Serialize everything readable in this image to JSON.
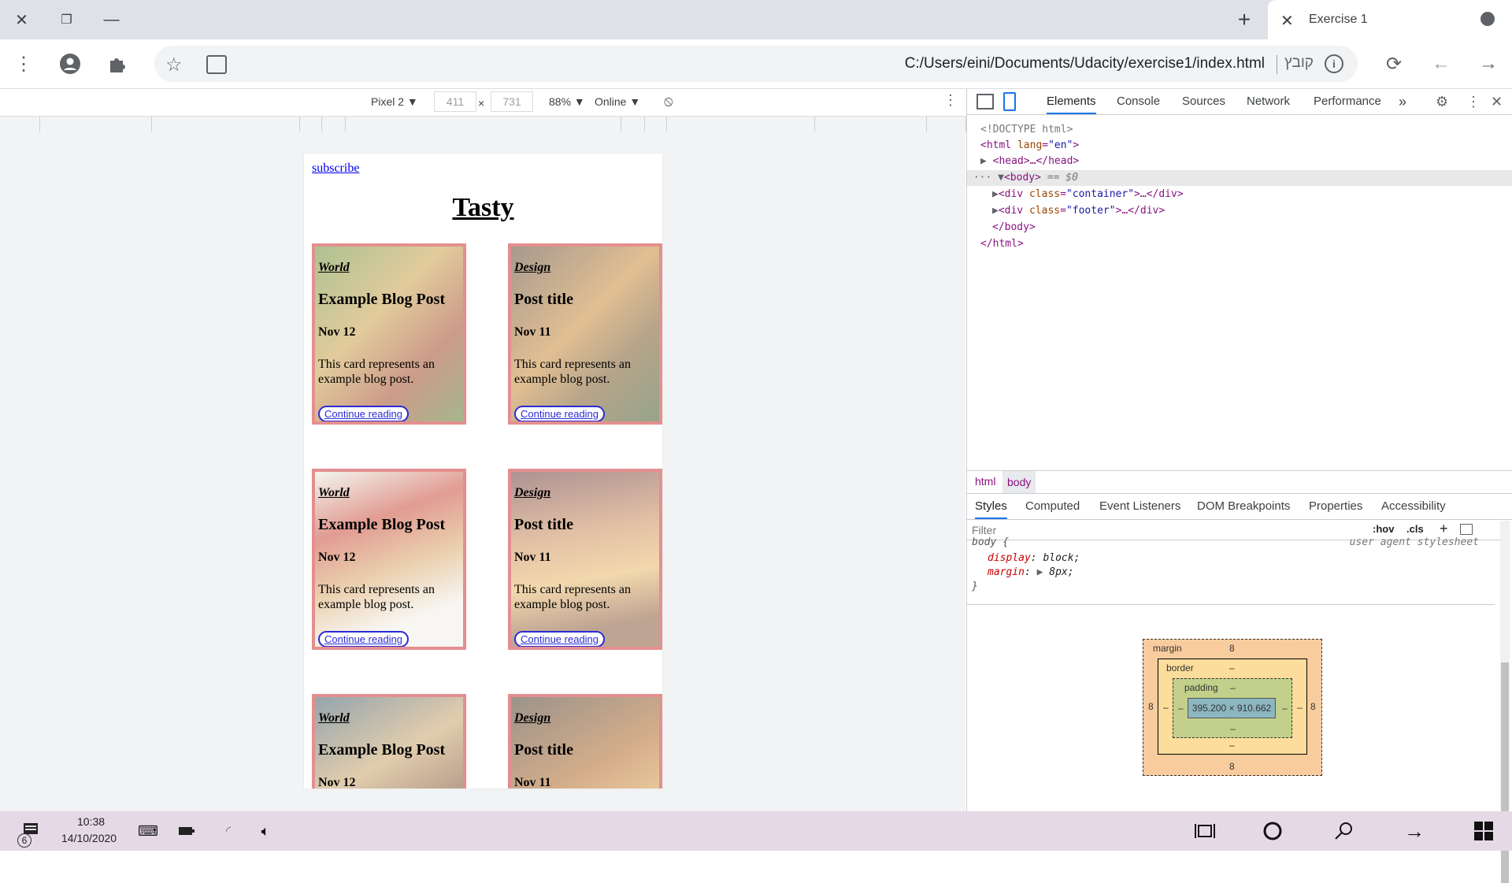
{
  "window": {
    "tab_title": "Exercise 1",
    "new_tab": "+"
  },
  "toolbar": {
    "url": "C:/Users/eini/Documents/Udacity/exercise1/index.html",
    "url_file_label": "קובץ",
    "info": "i"
  },
  "device_toolbar": {
    "device": "Pixel 2 ▼",
    "width": "411",
    "times": "×",
    "height": "731",
    "zoom": "88% ▼",
    "network": "Online ▼"
  },
  "site": {
    "subscribe": "subscribe",
    "brand": "Tasty",
    "cards": [
      {
        "category": "World",
        "title": "Example Blog Post",
        "date": "Nov 12",
        "desc": "This card represents an example blog post.",
        "button": "Continue reading"
      },
      {
        "category": "Design",
        "title": "Post title",
        "date": "Nov 11",
        "desc": "This card represents an example blog post.",
        "button": "Continue reading"
      },
      {
        "category": "World",
        "title": "Example Blog Post",
        "date": "Nov 12",
        "desc": "This card represents an example blog post.",
        "button": "Continue reading"
      },
      {
        "category": "Design",
        "title": "Post title",
        "date": "Nov 11",
        "desc": "This card represents an example blog post.",
        "button": "Continue reading"
      },
      {
        "category": "World",
        "title": "Example Blog Post",
        "date": "Nov 12"
      },
      {
        "category": "Design",
        "title": "Post title",
        "date": "Nov 11"
      }
    ]
  },
  "devtools": {
    "tabs": [
      "Elements",
      "Console",
      "Sources",
      "Network",
      "Performance"
    ],
    "more": "»",
    "dom": {
      "doctype": "<!DOCTYPE html>",
      "html_open": "<html",
      "lang_attr": "lang",
      "lang_val": "\"en\"",
      "head": "<head>…</head>",
      "body_open": "<body>",
      "body_eq": "== $0",
      "div_open": "<div",
      "class_attr": "class",
      "container_val": "\"container\"",
      "footer_val": "\"footer\"",
      "div_close": ">…</div>",
      "body_close": "</body>",
      "html_close": "</html>"
    },
    "breadcrumbs": [
      "html",
      "body"
    ],
    "style_tabs": [
      "Styles",
      "Computed",
      "Event Listeners",
      "DOM Breakpoints",
      "Properties",
      "Accessibility"
    ],
    "filter_placeholder": "Filter",
    "hov": ":hov",
    "cls": ".cls",
    "rules": {
      "selector_partial": "body {",
      "source": "user agent stylesheet",
      "prop1": "display",
      "val1": "block;",
      "prop2": "margin",
      "val2": "8px;",
      "close": "}"
    },
    "box_model": {
      "margin_label": "margin",
      "margin_top": "8",
      "margin_bottom": "8",
      "margin_left": "8",
      "margin_right": "8",
      "border_label": "border",
      "border_val": "–",
      "padding_label": "padding",
      "padding_val": "–",
      "content": "395.200 × 910.662"
    }
  },
  "taskbar": {
    "time": "10:38",
    "date": "14/10/2020",
    "notification_count": "6"
  }
}
